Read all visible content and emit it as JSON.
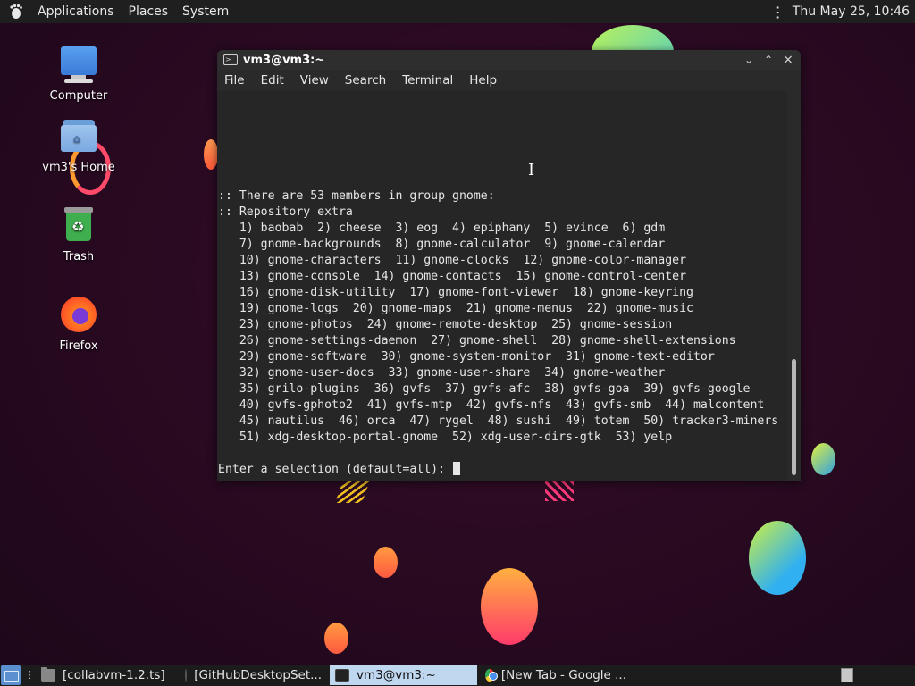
{
  "top_panel": {
    "menus": [
      "Applications",
      "Places",
      "System"
    ],
    "clock": "Thu May 25, 10:46"
  },
  "desktop": {
    "icons": [
      {
        "label": "Computer",
        "icon": "computer-icon"
      },
      {
        "label": "vm3's Home",
        "icon": "home-folder-icon"
      },
      {
        "label": "Trash",
        "icon": "trash-icon"
      },
      {
        "label": "Firefox",
        "icon": "firefox-icon"
      }
    ]
  },
  "terminal": {
    "title": "vm3@vm3:~",
    "menus": [
      "File",
      "Edit",
      "View",
      "Search",
      "Terminal",
      "Help"
    ],
    "lines": [
      ":: There are 53 members in group gnome:",
      ":: Repository extra",
      "   1) baobab  2) cheese  3) eog  4) epiphany  5) evince  6) gdm",
      "   7) gnome-backgrounds  8) gnome-calculator  9) gnome-calendar",
      "   10) gnome-characters  11) gnome-clocks  12) gnome-color-manager",
      "   13) gnome-console  14) gnome-contacts  15) gnome-control-center",
      "   16) gnome-disk-utility  17) gnome-font-viewer  18) gnome-keyring",
      "   19) gnome-logs  20) gnome-maps  21) gnome-menus  22) gnome-music",
      "   23) gnome-photos  24) gnome-remote-desktop  25) gnome-session",
      "   26) gnome-settings-daemon  27) gnome-shell  28) gnome-shell-extensions",
      "   29) gnome-software  30) gnome-system-monitor  31) gnome-text-editor",
      "   32) gnome-user-docs  33) gnome-user-share  34) gnome-weather",
      "   35) grilo-plugins  36) gvfs  37) gvfs-afc  38) gvfs-goa  39) gvfs-google",
      "   40) gvfs-gphoto2  41) gvfs-mtp  42) gvfs-nfs  43) gvfs-smb  44) malcontent",
      "   45) nautilus  46) orca  47) rygel  48) sushi  49) totem  50) tracker3-miners",
      "   51) xdg-desktop-portal-gnome  52) xdg-user-dirs-gtk  53) yelp"
    ],
    "prompt": "Enter a selection (default=all): "
  },
  "taskbar": {
    "tasks": [
      {
        "label": "[collabvm-1.2.ts]",
        "icon": "folder-icon",
        "active": false
      },
      {
        "label": "[GitHubDesktopSet...",
        "icon": "github-desktop-icon",
        "active": false
      },
      {
        "label": "vm3@vm3:~",
        "icon": "terminal-icon",
        "active": true
      },
      {
        "label": "[New Tab - Google ...",
        "icon": "chrome-icon",
        "active": false
      }
    ]
  },
  "colors": {
    "panel_bg": "#1f1f1f",
    "terminal_bg": "#262626",
    "active_task_bg": "#bfd7ef",
    "wallpaper_bg": "#2a0a22"
  }
}
